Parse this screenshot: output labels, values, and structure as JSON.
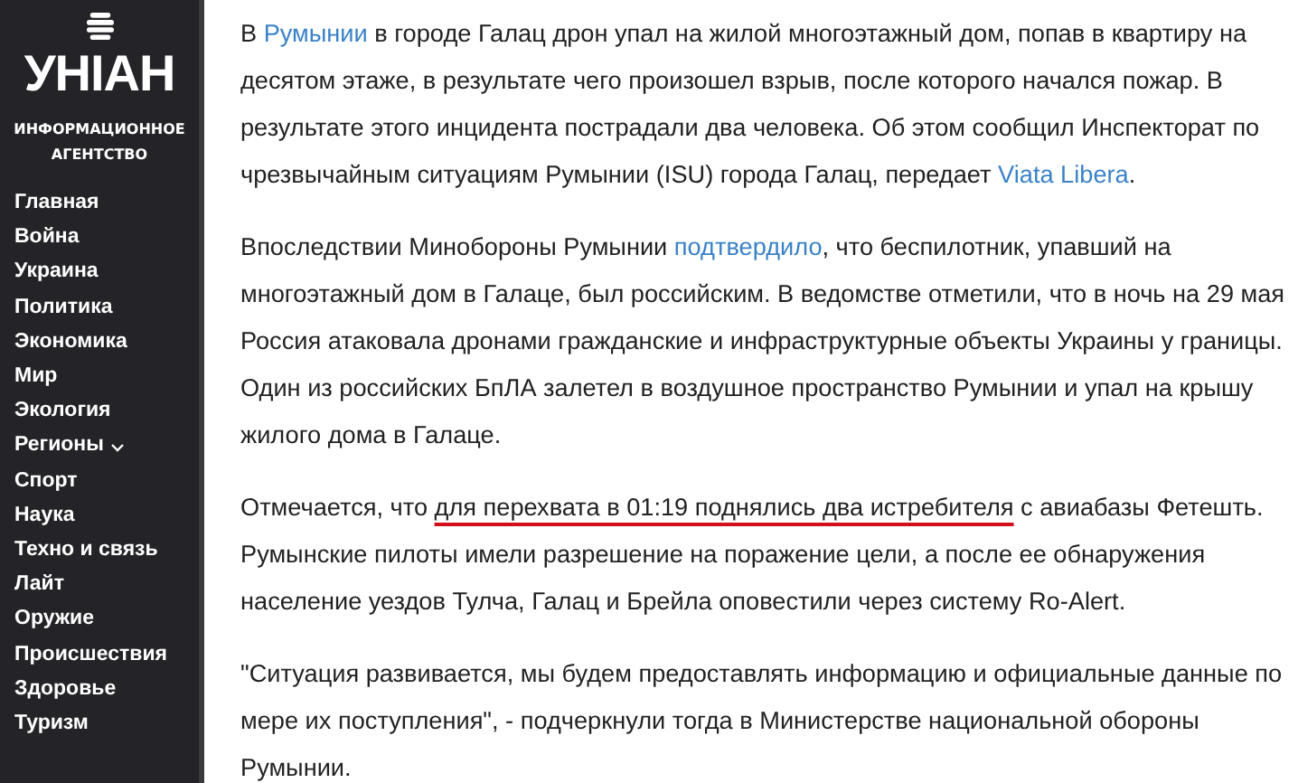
{
  "logo": {
    "wordmark": "УНІАН",
    "tagline": [
      "ИНФОРМАЦИОННОЕ",
      "АГЕНТСТВО"
    ]
  },
  "menu": [
    {
      "label": "Главная",
      "kind": "link"
    },
    {
      "label": "Война",
      "kind": "link"
    },
    {
      "label": "Украина",
      "kind": "link"
    },
    {
      "label": "Политика",
      "kind": "link"
    },
    {
      "label": "Экономика",
      "kind": "link"
    },
    {
      "label": "Мир",
      "kind": "link"
    },
    {
      "label": "Экология",
      "kind": "link"
    },
    {
      "label": "Регионы",
      "kind": "dropdown"
    },
    {
      "label": "Спорт",
      "kind": "link"
    },
    {
      "label": "Наука",
      "kind": "link"
    },
    {
      "label": "Техно и связь",
      "kind": "link"
    },
    {
      "label": "Лайт",
      "kind": "link"
    },
    {
      "label": "Оружие",
      "kind": "link"
    },
    {
      "label": "Происшествия",
      "kind": "link"
    },
    {
      "label": "Здоровье",
      "kind": "link"
    },
    {
      "label": "Туризм",
      "kind": "link"
    }
  ],
  "article": [
    {
      "lines": [
        [
          {
            "kind": "text",
            "text": "В "
          },
          {
            "kind": "link",
            "text": "Румынии"
          },
          {
            "kind": "text",
            "text": " в городе Галац дрон упал на жилой многоэтажный дом, попав в квартиру на"
          }
        ],
        [
          {
            "kind": "text",
            "text": "десятом этаже, в результате чего произошел взрыв, после которого начался пожар. В"
          }
        ],
        [
          {
            "kind": "text",
            "text": "результате этого инцидента пострадали два человека. Об этом сообщил Инспекторат по"
          }
        ],
        [
          {
            "kind": "text",
            "text": "чрезвычайным ситуациям Румынии (ISU) города Галац, передает "
          },
          {
            "kind": "link",
            "text": "Viata Libera"
          },
          {
            "kind": "text",
            "text": "."
          }
        ]
      ]
    },
    {
      "lines": [
        [
          {
            "kind": "text",
            "text": "Впоследствии Минобороны Румынии "
          },
          {
            "kind": "link",
            "text": "подтвердило"
          },
          {
            "kind": "text",
            "text": ", что беспилотник, упавший на"
          }
        ],
        [
          {
            "kind": "text",
            "text": "многоэтажный дом в Галаце, был российским. В ведомстве отметили, что в ночь на 29 мая"
          }
        ],
        [
          {
            "kind": "text",
            "text": "Россия атаковала дронами гражданские и инфраструктурные объекты Украины у границы."
          }
        ],
        [
          {
            "kind": "text",
            "text": "Один из российских БпЛА залетел в воздушное пространство Румынии и упал на крышу"
          }
        ],
        [
          {
            "kind": "text",
            "text": "жилого дома в Галаце."
          }
        ]
      ]
    },
    {
      "lines": [
        [
          {
            "kind": "text",
            "text": "Отмечается, что "
          },
          {
            "kind": "marked",
            "text": "для перехвата в 01:19 поднялись два истребителя"
          },
          {
            "kind": "text",
            "text": " с авиабазы Фетешть."
          }
        ],
        [
          {
            "kind": "text",
            "text": "Румынские пилоты имели разрешение на поражение цели, а после ее обнаружения"
          }
        ],
        [
          {
            "kind": "text",
            "text": "население уездов Тулча, Галац и Брейла оповестили через систему Ro-Alert."
          }
        ]
      ]
    },
    {
      "lines": [
        [
          {
            "kind": "text",
            "text": "\"Ситуация развивается, мы будем предоставлять информацию и официальные данные по"
          }
        ],
        [
          {
            "kind": "text",
            "text": "мере их поступления\", - подчеркнули тогда в Министерстве национальной обороны"
          }
        ],
        [
          {
            "kind": "text",
            "text": "Румынии."
          }
        ]
      ]
    }
  ]
}
